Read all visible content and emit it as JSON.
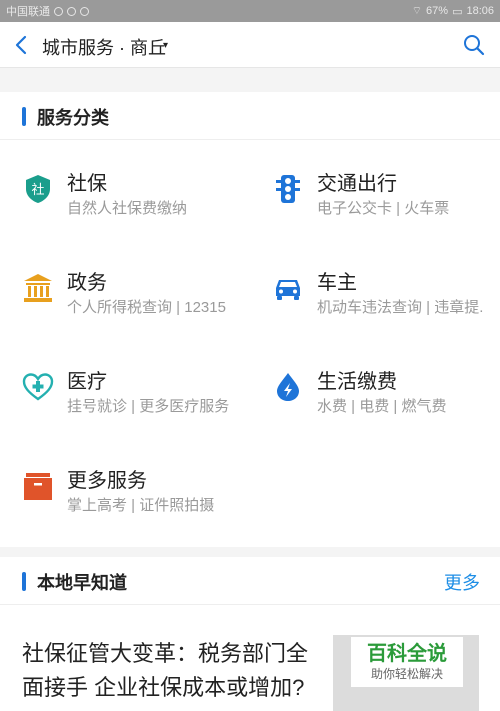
{
  "status_bar": {
    "carrier": "中国联通",
    "battery": "67%",
    "time": "18:06"
  },
  "header": {
    "title": "城市服务 · 商丘",
    "caret": "▾"
  },
  "services": {
    "section_title": "服务分类",
    "items": [
      {
        "name": "社保",
        "desc": "自然人社保费缴纳",
        "icon": "shield-icon",
        "icon_text": "社",
        "color": "#1a9e8c"
      },
      {
        "name": "交通出行",
        "desc": "电子公交卡 | 火车票",
        "icon": "traffic-light-icon",
        "color": "#1e74d8"
      },
      {
        "name": "政务",
        "desc": "个人所得税查询 | 12315",
        "icon": "government-building-icon",
        "color": "#e8a01e"
      },
      {
        "name": "车主",
        "desc": "机动车违法查询 | 违章提.",
        "icon": "car-icon",
        "color": "#1e74d8"
      },
      {
        "name": "医疗",
        "desc": "挂号就诊 | 更多医疗服务",
        "icon": "medical-heart-icon",
        "color": "#24b0b0"
      },
      {
        "name": "生活缴费",
        "desc": "水费 | 电费 | 燃气费",
        "icon": "water-drop-icon",
        "color": "#1e74d8"
      },
      {
        "name": "更多服务",
        "desc": "掌上高考 | 证件照拍摄",
        "icon": "box-icon",
        "color": "#e0542a"
      }
    ]
  },
  "local": {
    "section_title": "本地早知道",
    "more_label": "更多",
    "news_title": "社保征管大变革：税务部门全面接手 企业社保成本或增加?",
    "thumb_title": "百科全说",
    "thumb_subtitle": "助你轻松解决"
  }
}
